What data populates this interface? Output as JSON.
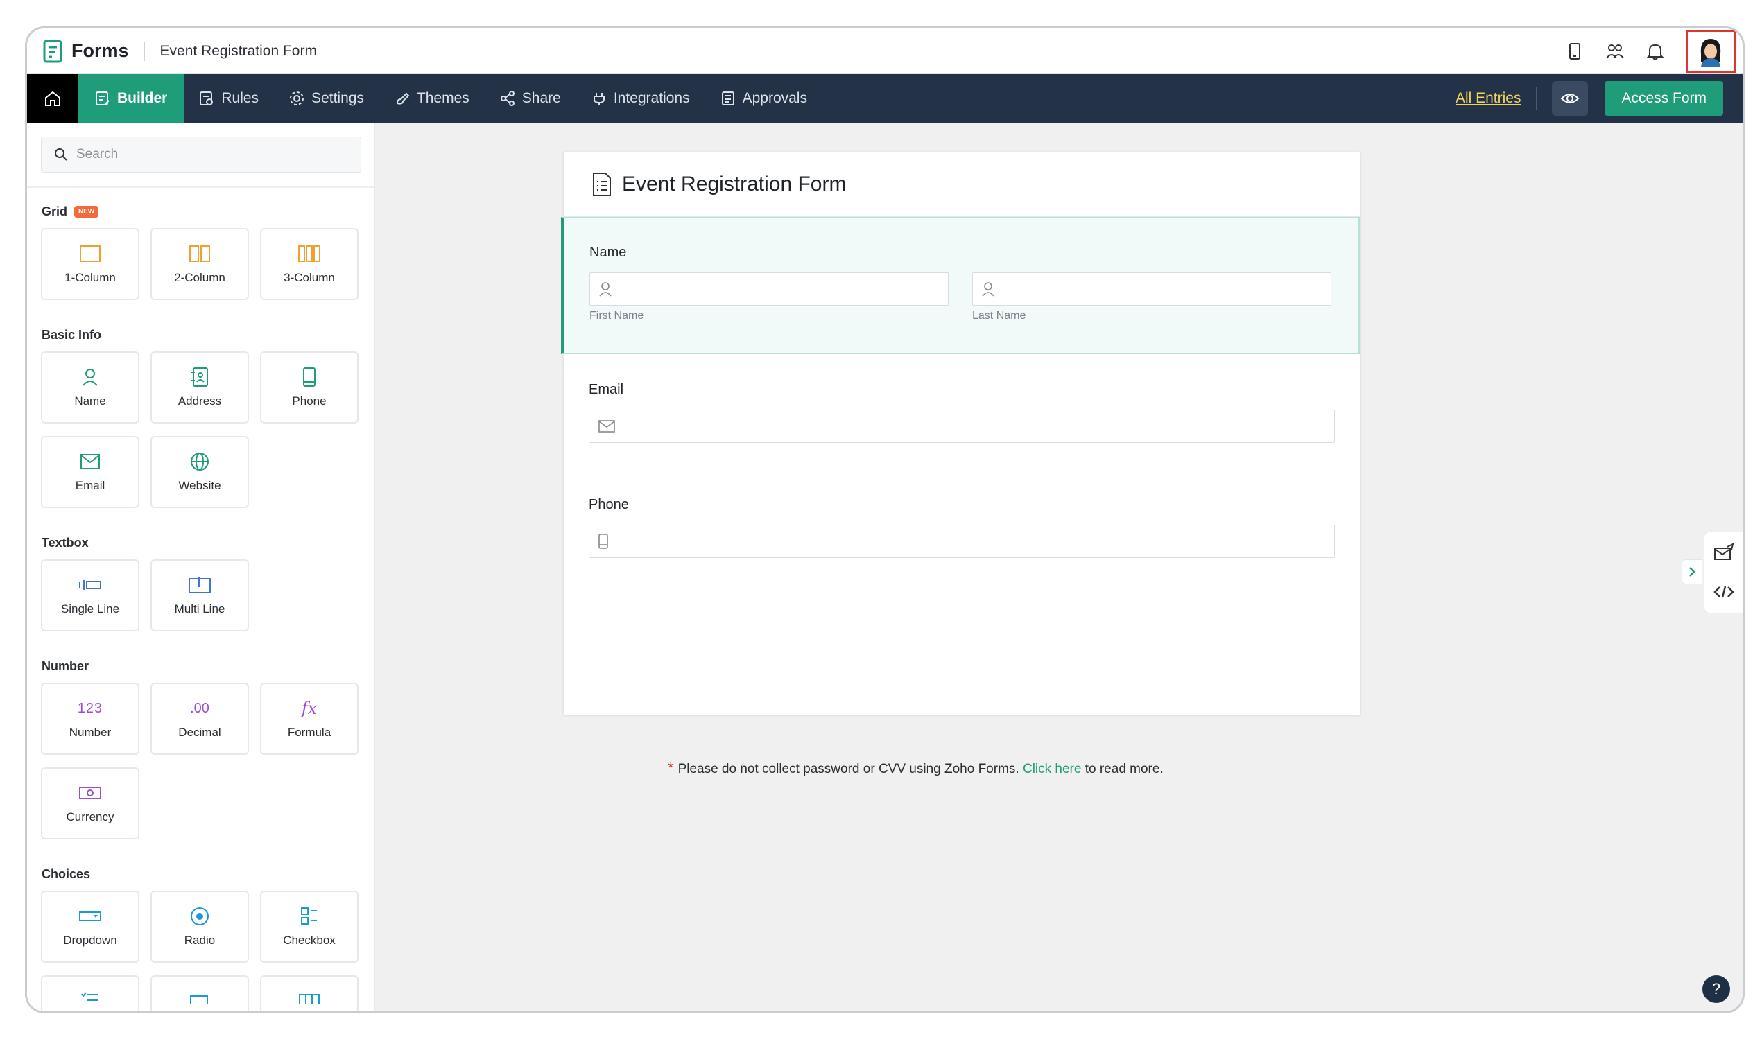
{
  "header": {
    "app_name": "Forms",
    "form_title": "Event Registration Form",
    "icons": [
      "mobile-icon",
      "users-icon",
      "bell-icon",
      "avatar"
    ]
  },
  "nav": {
    "home_icon": "home-icon",
    "items": [
      {
        "label": "Builder",
        "icon": "builder-icon",
        "active": true
      },
      {
        "label": "Rules",
        "icon": "rules-icon"
      },
      {
        "label": "Settings",
        "icon": "gear-icon"
      },
      {
        "label": "Themes",
        "icon": "brush-icon"
      },
      {
        "label": "Share",
        "icon": "share-icon"
      },
      {
        "label": "Integrations",
        "icon": "plug-icon"
      },
      {
        "label": "Approvals",
        "icon": "approvals-icon"
      }
    ],
    "all_entries": "All Entries",
    "access_form": "Access Form"
  },
  "sidebar": {
    "search_placeholder": "Search",
    "sections": {
      "grid": {
        "title": "Grid",
        "badge": "NEW",
        "items": [
          "1-Column",
          "2-Column",
          "3-Column"
        ]
      },
      "basic": {
        "title": "Basic Info",
        "items": [
          "Name",
          "Address",
          "Phone",
          "Email",
          "Website"
        ]
      },
      "textbox": {
        "title": "Textbox",
        "items": [
          "Single Line",
          "Multi Line"
        ]
      },
      "number": {
        "title": "Number",
        "items": [
          "Number",
          "Decimal",
          "Formula",
          "Currency"
        ]
      },
      "choices": {
        "title": "Choices",
        "items": [
          "Dropdown",
          "Radio",
          "Checkbox"
        ]
      }
    },
    "icon_glyphs": {
      "number": "123",
      "decimal": ".00",
      "formula": "fx"
    }
  },
  "form": {
    "title": "Event Registration Form",
    "fields": {
      "name": {
        "label": "Name",
        "first": "First Name",
        "last": "Last Name"
      },
      "email": {
        "label": "Email"
      },
      "phone": {
        "label": "Phone"
      }
    }
  },
  "note": {
    "star": "*",
    "text_before": "Please do not collect password or CVV using Zoho Forms.",
    "link": "Click here",
    "text_after": "to read more."
  },
  "help": {
    "label": "?"
  },
  "colors": {
    "accent": "#1f9d7a",
    "nav_bg": "#233246",
    "highlight": "#e0342f"
  }
}
